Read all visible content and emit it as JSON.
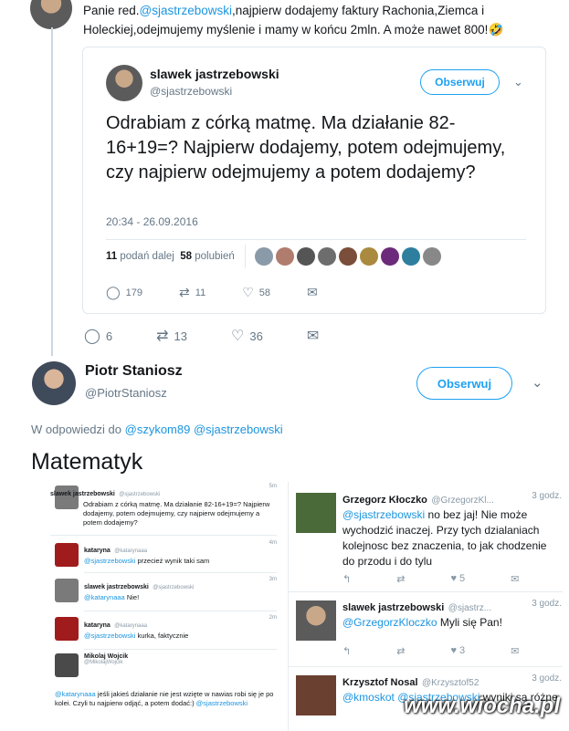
{
  "top_tweet": {
    "text_prefix": "Panie red.",
    "mention": "@sjastrzebowski",
    "text": ",najpierw  dodajemy faktury Rachonia,Ziemca i Holeckiej,odejmujemy myślenie i mamy w końcu 2mln. A może nawet 800!",
    "emoji": "🤣",
    "replies": "6",
    "retweets": "13",
    "likes": "36"
  },
  "quoted": {
    "name": "slawek jastrzebowski",
    "handle": "@sjastrzebowski",
    "follow": "Obserwuj",
    "text": "Odrabiam z córką matmę. Ma działanie 82-16+19=? Najpierw dodajemy, potem odejmujemy, czy najpierw odejmujemy a potem dodajemy?",
    "timestamp": "20:34 - 26.09.2016",
    "retweets_count": "11",
    "retweets_label": "podań dalej",
    "likes_count": "58",
    "likes_label": "polubień",
    "replies": "179",
    "retweets": "11",
    "likes": "58"
  },
  "reply": {
    "name": "Piotr Staniosz",
    "handle": "@PiotrStaniosz",
    "follow": "Obserwuj",
    "in_reply_to": "W odpowiedzi do",
    "mention1": "@szykom89",
    "mention2": "@sjastrzebowski",
    "text": "Matematyk"
  },
  "left_shot": [
    {
      "name": "slawek jastrzebowski",
      "handle": "@sjastrzebowski",
      "time": "5m",
      "text": "Odrabiam z córką matmę. Ma działanie 82-16+19=? Najpierw dodajemy, potem odejmujemy, czy najpierw odejmujemy a potem dodajemy?"
    },
    {
      "name": "kataryna",
      "handle": "@katarynaaa",
      "time": "4m",
      "mention": "@sjastrzebowski",
      "text": " przecież wynik taki sam"
    },
    {
      "name": "slawek jastrzebowski",
      "handle": "@sjastrzebowski",
      "time": "3m",
      "mention": "@katarynaaa",
      "text": " Nie!"
    },
    {
      "name": "kataryna",
      "handle": "@katarynaaa",
      "time": "2m",
      "mention": "@sjastrzebowski",
      "text": " kurka, faktycznie"
    },
    {
      "name": "Mikolaj Wojcik",
      "handle": "@MikolajWojcik",
      "time": "",
      "mention": "@katarynaaa",
      "text": " jeśli jakieś działanie nie jest wzięte w nawias robi się je po kolei. Czyli tu najpierw odjąć, a potem dodać:) ",
      "mention2": "@sjastrzebowski"
    }
  ],
  "right_shot": [
    {
      "name": "Grzegorz Kłoczko",
      "handle": "@GrzegorzKl...",
      "time": "3 godz.",
      "mention": "@sjastrzebowski",
      "text": " no bez jaj! Nie może wychodzić inaczej. Przy tych dzialaniach kolejnosc bez znaczenia, to jak chodzenie do przodu i do tylu",
      "likes": "5"
    },
    {
      "name": "slawek jastrzebowski",
      "handle": "@sjastrz...",
      "time": "3 godz.",
      "mention": "@GrzegorzKloczko",
      "text": " Myli się Pan!",
      "likes": "3"
    },
    {
      "name": "Krzysztof Nosal",
      "handle": "@Krzysztof52",
      "time": "3 godz.",
      "mention": "@kmoskot @sjastrzebowski",
      "text": " wyniki sa różne",
      "likes": ""
    }
  ],
  "watermark": "www.wiocha.pl"
}
